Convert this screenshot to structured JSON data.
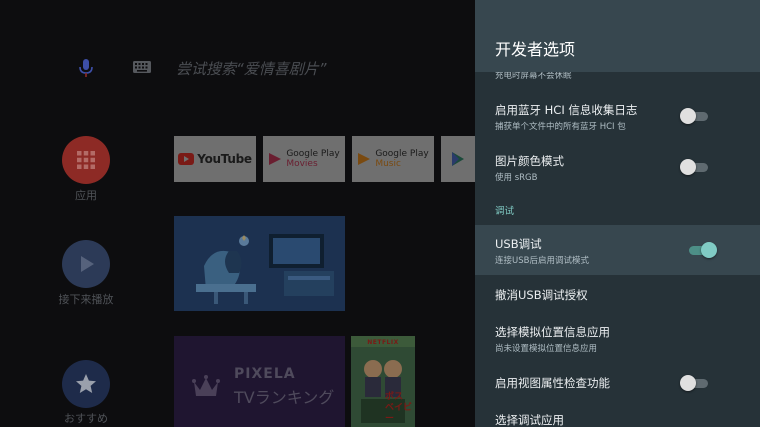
{
  "home": {
    "search_hint": "尝试搜索“爱情喜剧片”",
    "side_items": [
      {
        "label": "应用"
      },
      {
        "label": "接下来播放"
      },
      {
        "label": "おすすめ"
      }
    ],
    "tiles": {
      "youtube": "YouTube",
      "movies": [
        "Google Play",
        "Movies"
      ],
      "music": [
        "Google Play",
        "Music"
      ],
      "pixela": [
        "PIXELA",
        "TVランキング"
      ],
      "netflix": "NETFLIX",
      "boss": "ボス ベイビー"
    },
    "colors": {
      "apps_red": "#8d2a25",
      "play_blue": "#2c3a57",
      "star_blue": "#1e2b4a"
    }
  },
  "panel": {
    "title": "开发者选项",
    "partial_top": "充电时屏幕不会休眠",
    "items": [
      {
        "title": "启用蓝牙 HCI 信息收集日志",
        "subtitle": "捕获单个文件中的所有蓝牙 HCI 包",
        "switch": false
      },
      {
        "title": "图片颜色模式",
        "subtitle": "使用 sRGB",
        "switch": false
      },
      {
        "category": "调试"
      },
      {
        "title": "USB调试",
        "subtitle": "连接USB后启用调试模式",
        "switch": true,
        "highlighted": true
      },
      {
        "title": "撤消USB调试授权"
      },
      {
        "title": "选择模拟位置信息应用",
        "subtitle": "尚未设置模拟位置信息应用"
      },
      {
        "title": "启用视图属性检查功能",
        "switch": false
      },
      {
        "title": "选择调试应用"
      }
    ],
    "colors": {
      "bg": "#263238",
      "header": "#37474f",
      "accent": "#80cbc4"
    }
  }
}
